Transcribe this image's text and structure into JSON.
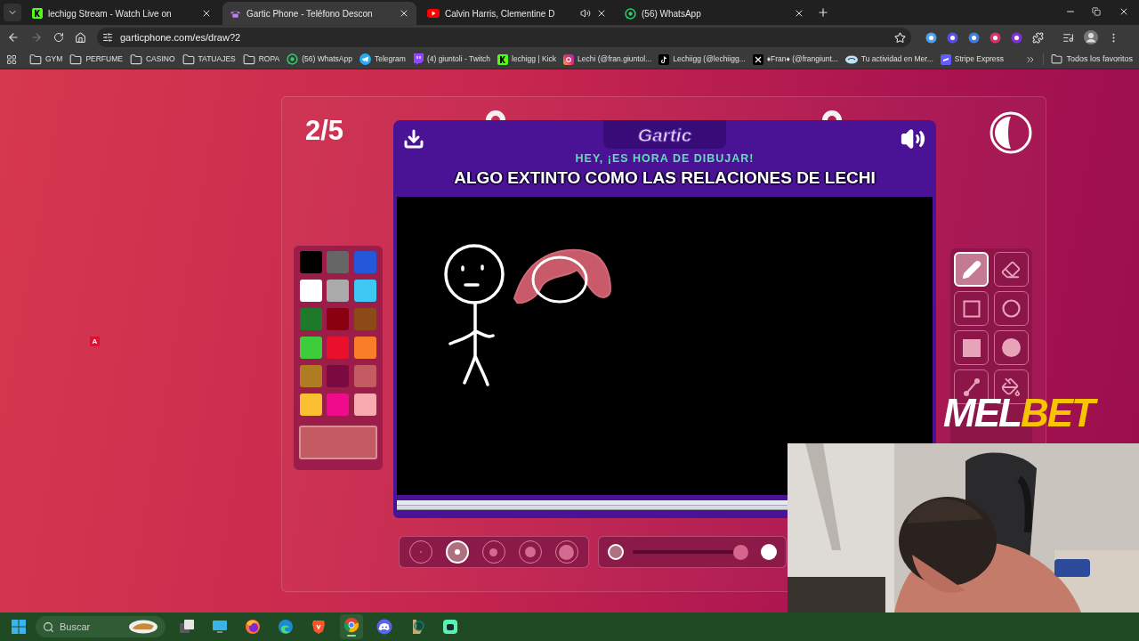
{
  "browser": {
    "tabs": [
      {
        "title": "lechigg Stream - Watch Live on",
        "kind": "kick",
        "audio": false,
        "selected": false
      },
      {
        "title": "Gartic Phone - Teléfono Descon",
        "kind": "gartic",
        "audio": false,
        "selected": true
      },
      {
        "title": "Calvin Harris, Clementine D",
        "kind": "youtube",
        "audio": true,
        "selected": false
      },
      {
        "title": "(56) WhatsApp",
        "kind": "whatsapp",
        "audio": false,
        "selected": false
      }
    ],
    "url": "garticphone.com/es/draw?2",
    "bookmarks": [
      {
        "label": "GYM",
        "kind": "folder"
      },
      {
        "label": "PERFUME",
        "kind": "folder"
      },
      {
        "label": "CASINO",
        "kind": "folder"
      },
      {
        "label": "TATUAJES",
        "kind": "folder"
      },
      {
        "label": "ROPA",
        "kind": "folder"
      },
      {
        "label": "(56) WhatsApp",
        "kind": "whatsapp"
      },
      {
        "label": "Telegram",
        "kind": "telegram"
      },
      {
        "label": "(4) giuntoli - Twitch",
        "kind": "twitch"
      },
      {
        "label": "lechigg | Kick",
        "kind": "kick"
      },
      {
        "label": "Lechi (@fran.giuntol...",
        "kind": "instagram"
      },
      {
        "label": "Lechiigg (@lechiigg...",
        "kind": "tiktok"
      },
      {
        "label": "♦Fran♦ (@frangiunt...",
        "kind": "x"
      },
      {
        "label": "Tu actividad en Mer...",
        "kind": "mercado"
      },
      {
        "label": "Stripe Express",
        "kind": "stripe"
      }
    ],
    "all_bookmarks": "Todos los favoritos"
  },
  "game": {
    "round": "2/5",
    "logo": "Gartic",
    "subtitle": "HEY, ¡ES HORA DE DIBUJAR!",
    "prompt": "ALGO EXTINTO COMO LAS RELACIONES DE LECHI",
    "palette": [
      {
        "color": "#000000"
      },
      {
        "color": "#666666"
      },
      {
        "color": "#2458d8"
      },
      {
        "color": "#ffffff"
      },
      {
        "color": "#aaaaaa"
      },
      {
        "color": "#3fc8f4"
      },
      {
        "color": "#1e7a28"
      },
      {
        "color": "#8a0010"
      },
      {
        "color": "#8c4a18"
      },
      {
        "color": "#3ccc3c"
      },
      {
        "color": "#e8102a"
      },
      {
        "color": "#fa7d2a"
      },
      {
        "color": "#b07c22"
      },
      {
        "color": "#7a0a40"
      },
      {
        "color": "#c45a62"
      },
      {
        "color": "#fac032"
      },
      {
        "color": "#f00a8c"
      },
      {
        "color": "#f8aab0"
      }
    ],
    "current_color": {
      "color": "#c45a62"
    },
    "tools": [
      {
        "kind": "pencil",
        "selected": true
      },
      {
        "kind": "eraser",
        "selected": false
      },
      {
        "kind": "rect",
        "selected": false
      },
      {
        "kind": "ellipse",
        "selected": false
      },
      {
        "kind": "rect_fill",
        "selected": false
      },
      {
        "kind": "ellipse_fill",
        "selected": false
      },
      {
        "kind": "line",
        "selected": false
      },
      {
        "kind": "bucket",
        "selected": false
      }
    ],
    "brush_sizes": [
      {
        "selected": false
      },
      {
        "selected": true
      },
      {
        "selected": false
      },
      {
        "selected": false
      },
      {
        "selected": false
      }
    ],
    "opacity": {
      "level": 1
    }
  },
  "marker": "A",
  "overlay_logo": [
    "MEL",
    "BET"
  ],
  "taskbar": {
    "search_placeholder": "Buscar",
    "apps": [
      {
        "kind": "taskview",
        "selected": false
      },
      {
        "kind": "monitor",
        "selected": false
      },
      {
        "kind": "firefox",
        "selected": false
      },
      {
        "kind": "edge",
        "selected": false
      },
      {
        "kind": "brave",
        "selected": false
      },
      {
        "kind": "chrome",
        "selected": true
      },
      {
        "kind": "discord",
        "selected": false
      },
      {
        "kind": "league",
        "selected": false
      },
      {
        "kind": "app",
        "selected": false
      }
    ]
  }
}
